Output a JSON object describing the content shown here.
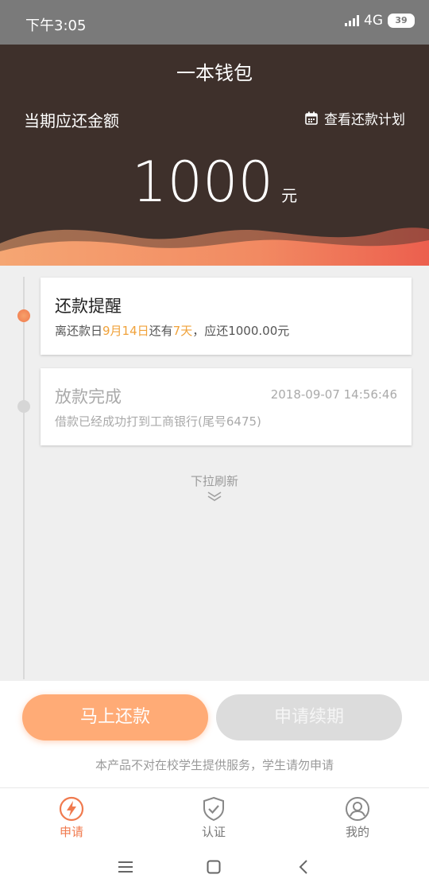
{
  "status_bar": {
    "time": "下午3:05",
    "network": "4G",
    "battery": "39"
  },
  "header": {
    "title": "一本钱包",
    "due_label": "当期应还金额",
    "plan_link": "查看还款计划",
    "amount": "1000",
    "unit": "元"
  },
  "timeline": {
    "reminder": {
      "title": "还款提醒",
      "desc_prefix": "离还款日",
      "due_date": "9月14日",
      "desc_mid": "还有",
      "days_left": "7天",
      "desc_suffix": "，应还1000.00元"
    },
    "loan": {
      "title": "放款完成",
      "timestamp": "2018-09-07 14:56:46",
      "desc": "借款已经成功打到工商银行(尾号6475)"
    },
    "pull_hint": "下拉刷新"
  },
  "actions": {
    "pay_label": "马上还款",
    "renew_label": "申请续期",
    "notice": "本产品不对在校学生提供服务，学生请勿申请"
  },
  "tabs": [
    {
      "label": "申请",
      "icon": "lightning-icon",
      "active": true
    },
    {
      "label": "认证",
      "icon": "shield-check-icon",
      "active": false
    },
    {
      "label": "我的",
      "icon": "user-icon",
      "active": false
    }
  ],
  "colors": {
    "header_bg": "#3e302b",
    "accent": "#f07a4e",
    "highlight": "#f0a23a",
    "pay_button": "#ffab76"
  }
}
